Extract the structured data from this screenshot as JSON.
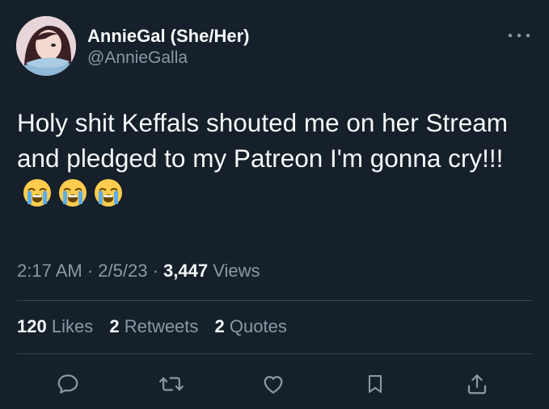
{
  "author": {
    "display_name": "AnnieGal (She/Her)",
    "handle": "@AnnieGalla"
  },
  "tweet": {
    "text": "Holy shit Keffals shouted me on her Stream and pledged to my Patreon I'm gonna cry!!!",
    "emojis": [
      "loudly-crying-face",
      "loudly-crying-face",
      "loudly-crying-face"
    ]
  },
  "meta": {
    "time": "2:17 AM",
    "sep1": "·",
    "date": "2/5/23",
    "sep2": "·",
    "views_count": "3,447",
    "views_label": "Views"
  },
  "stats": {
    "likes_count": "120",
    "likes_label": "Likes",
    "retweets_count": "2",
    "retweets_label": "Retweets",
    "quotes_count": "2",
    "quotes_label": "Quotes"
  },
  "actions": [
    "reply-icon",
    "retweet-icon",
    "like-icon",
    "bookmark-icon",
    "share-icon"
  ],
  "colors": {
    "background": "#15202b",
    "text": "#f7f9f9",
    "secondary": "#8b98a5",
    "divider": "#38444d"
  }
}
